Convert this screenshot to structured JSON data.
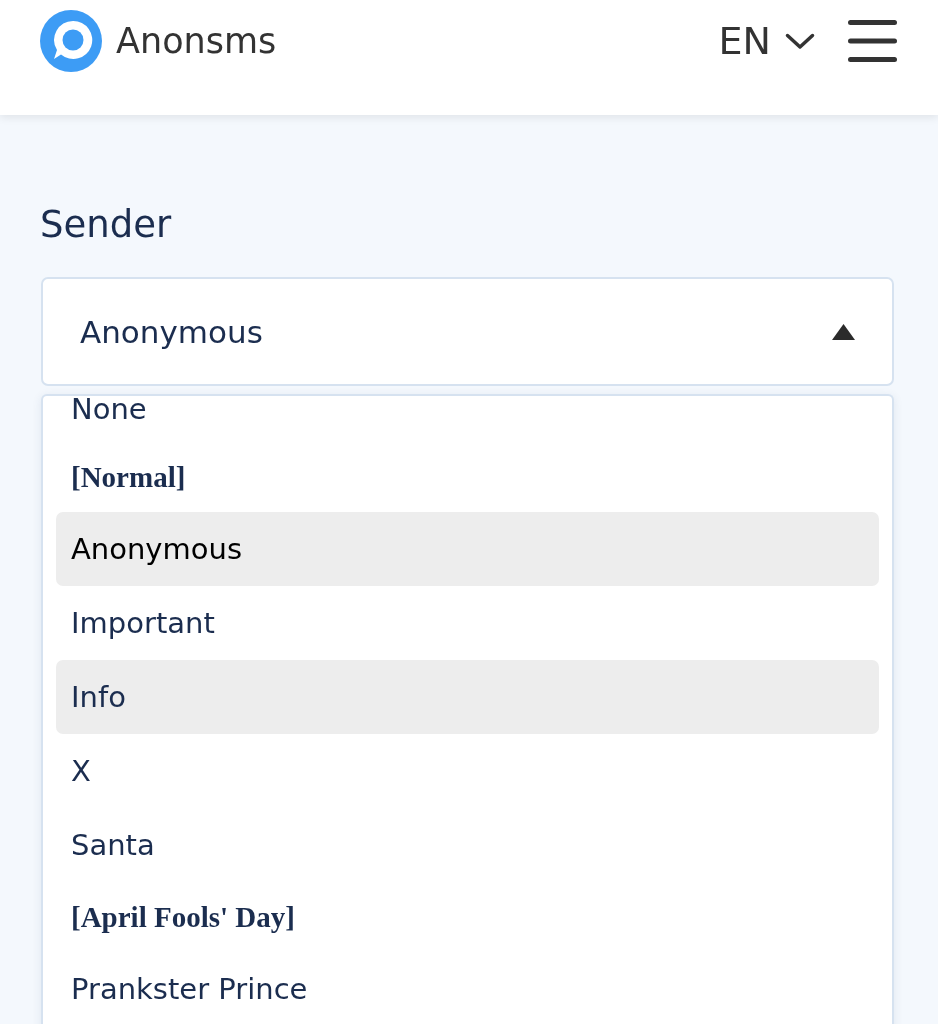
{
  "header": {
    "brand": "Anonsms",
    "language": "EN"
  },
  "sender": {
    "label": "Sender",
    "value": "Anonymous",
    "expanded": true,
    "options": [
      {
        "kind": "option",
        "label": "None",
        "selected": false,
        "highlighted": false
      },
      {
        "kind": "group",
        "label": "[Normal]"
      },
      {
        "kind": "option",
        "label": "Anonymous",
        "selected": true,
        "highlighted": true
      },
      {
        "kind": "option",
        "label": "Important",
        "selected": false,
        "highlighted": false
      },
      {
        "kind": "option",
        "label": "Info",
        "selected": false,
        "highlighted": true
      },
      {
        "kind": "option",
        "label": "X",
        "selected": false,
        "highlighted": false
      },
      {
        "kind": "option",
        "label": "Santa",
        "selected": false,
        "highlighted": false
      },
      {
        "kind": "group",
        "label": "[April Fools' Day]"
      },
      {
        "kind": "option",
        "label": "Prankster Prince",
        "selected": false,
        "highlighted": false
      }
    ]
  }
}
